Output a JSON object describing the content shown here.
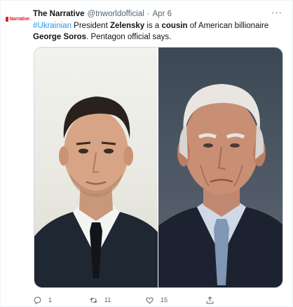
{
  "avatar": {
    "text": "Narrative",
    "icon": "narrative-logo",
    "brand_color": "#e0202a"
  },
  "author": {
    "display_name": "The Narrative",
    "handle": "@tnworldofficial",
    "separator": "·",
    "date": "Apr 6"
  },
  "more_label": "···",
  "tweet": {
    "hashtag": "#Ukrainian",
    "t1": " President ",
    "bold1": "Zelensky",
    "t2": " is a ",
    "bold2": "cousin",
    "t3": " of American billionaire ",
    "bold3": "George Soros",
    "t4": ". Pentagon official says."
  },
  "media": {
    "left_photo": "portrait-man-dark-hair-white-shirt",
    "right_photo": "portrait-elderly-man-glasses-suit"
  },
  "actions": {
    "reply_count": "1",
    "retweet_count": "11",
    "like_count": "15"
  },
  "colors": {
    "link": "#1d9bf0",
    "secondary": "#536471",
    "text": "#0f1419"
  }
}
